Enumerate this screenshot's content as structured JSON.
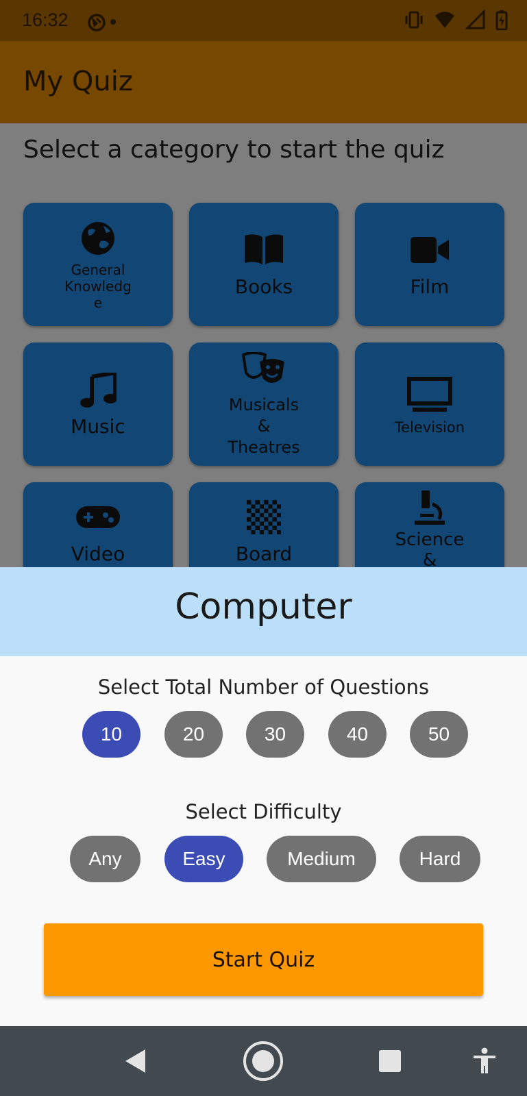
{
  "status": {
    "time": "16:32"
  },
  "app": {
    "title": "My Quiz"
  },
  "main": {
    "subtitle": "Select a category to start the quiz",
    "categories": [
      {
        "label": "General\nKnowledg\ne",
        "icon": "globe-icon"
      },
      {
        "label": "Books",
        "icon": "book-icon"
      },
      {
        "label": "Film",
        "icon": "video-camera-icon"
      },
      {
        "label": "Music",
        "icon": "music-note-icon"
      },
      {
        "label": "Musicals\n&\nTheatres",
        "icon": "theater-masks-icon"
      },
      {
        "label": "Television",
        "icon": "tv-icon"
      },
      {
        "label": "Video",
        "icon": "gamepad-icon"
      },
      {
        "label": "Board",
        "icon": "chessboard-icon"
      },
      {
        "label": "Science\n&",
        "icon": "microscope-icon"
      }
    ]
  },
  "sheet": {
    "title": "Computer",
    "questions_label": "Select Total Number of Questions",
    "question_counts": [
      "10",
      "20",
      "30",
      "40",
      "50"
    ],
    "selected_count": "10",
    "difficulty_label": "Select Difficulty",
    "difficulties": [
      "Any",
      "Easy",
      "Medium",
      "Hard"
    ],
    "selected_difficulty": "Easy",
    "start_label": "Start Quiz"
  },
  "colors": {
    "accent": "#3b4cb5",
    "tile": "#124674",
    "start": "#fd9800",
    "sheet_header": "#bcdff9"
  }
}
